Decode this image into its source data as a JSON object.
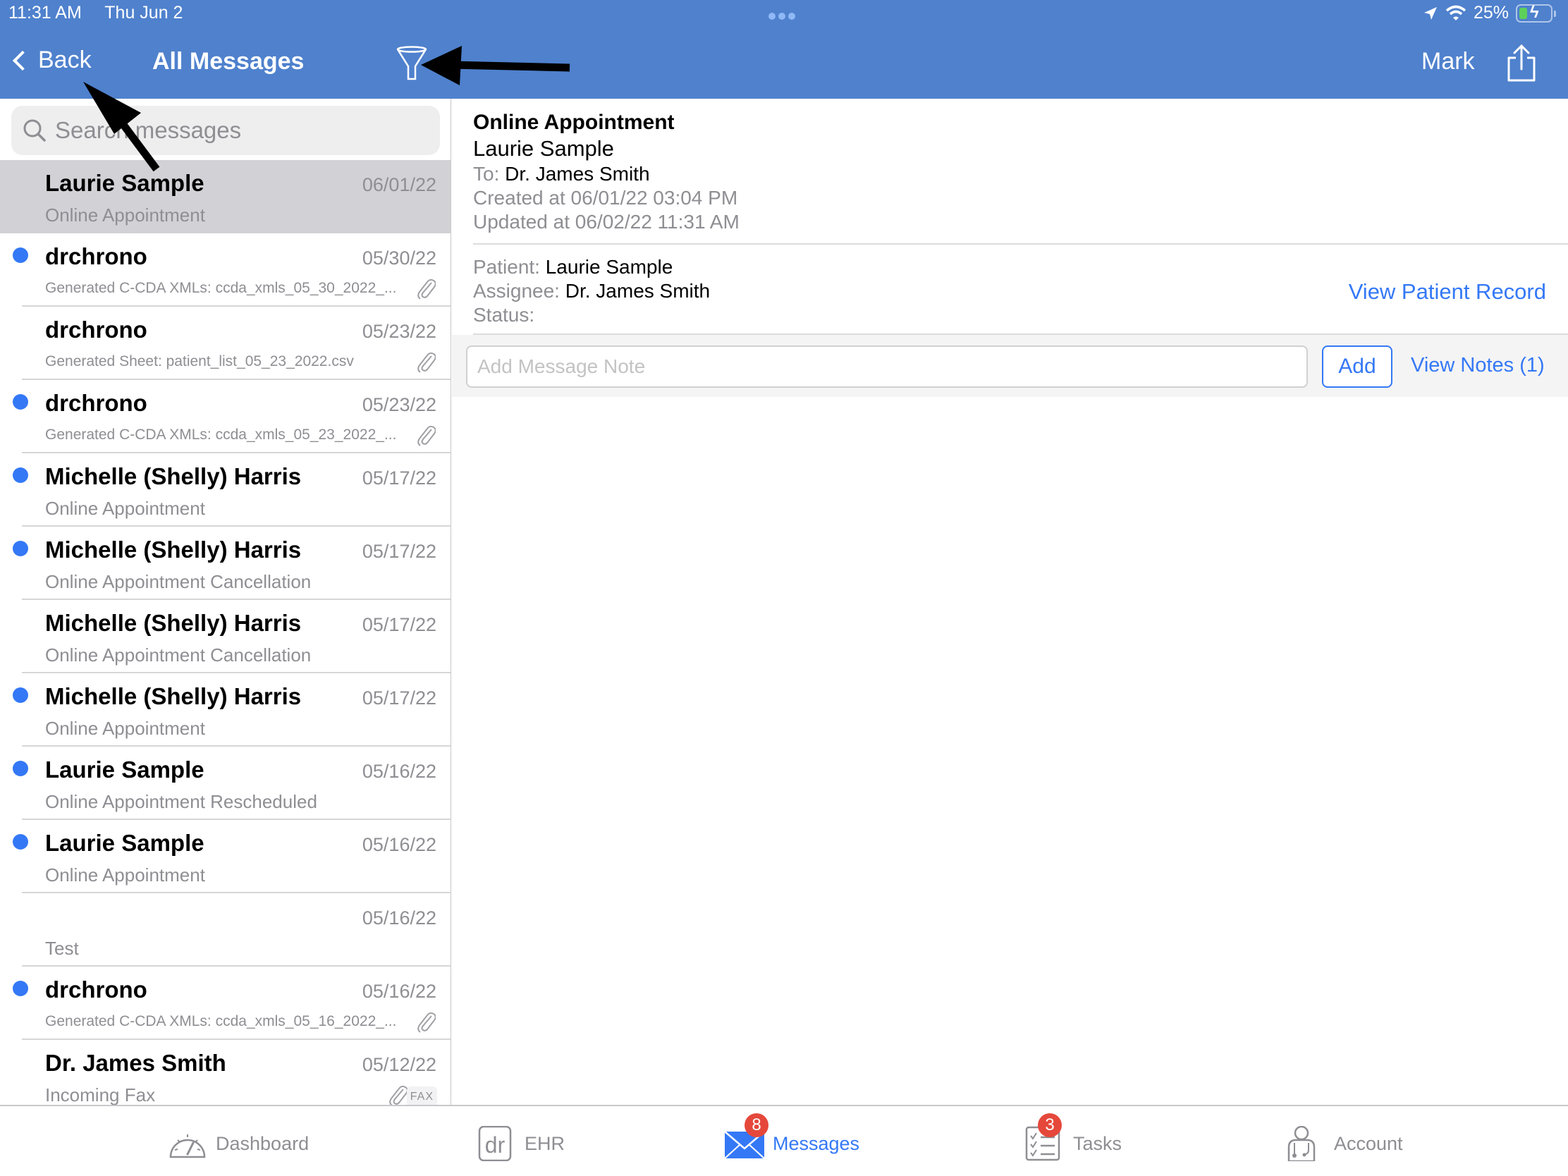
{
  "status_bar": {
    "time": "11:31 AM",
    "date": "Thu Jun 2",
    "battery": "25%"
  },
  "nav": {
    "back_label": "Back",
    "title": "All Messages",
    "mark_label": "Mark"
  },
  "search": {
    "placeholder": "Search messages"
  },
  "messages": [
    {
      "sender": "Laurie Sample",
      "date": "06/01/22",
      "subject": "Online Appointment",
      "unread": false,
      "selected": true,
      "attachment": false
    },
    {
      "sender": "drchrono",
      "date": "05/30/22",
      "subject": "Generated C-CDA XMLs: ccda_xmls_05_30_2022_...",
      "unread": true,
      "attachment": true
    },
    {
      "sender": "drchrono",
      "date": "05/23/22",
      "subject": "Generated Sheet: patient_list_05_23_2022.csv",
      "unread": false,
      "attachment": true
    },
    {
      "sender": "drchrono",
      "date": "05/23/22",
      "subject": "Generated C-CDA XMLs: ccda_xmls_05_23_2022_...",
      "unread": true,
      "attachment": true
    },
    {
      "sender": "Michelle (Shelly) Harris",
      "date": "05/17/22",
      "subject": "Online Appointment",
      "unread": true,
      "attachment": false
    },
    {
      "sender": "Michelle (Shelly) Harris",
      "date": "05/17/22",
      "subject": "Online Appointment Cancellation",
      "unread": true,
      "attachment": false
    },
    {
      "sender": "Michelle (Shelly) Harris",
      "date": "05/17/22",
      "subject": "Online Appointment Cancellation",
      "unread": false,
      "attachment": false
    },
    {
      "sender": "Michelle (Shelly) Harris",
      "date": "05/17/22",
      "subject": "Online Appointment",
      "unread": true,
      "attachment": false
    },
    {
      "sender": "Laurie Sample",
      "date": "05/16/22",
      "subject": "Online Appointment Rescheduled",
      "unread": true,
      "attachment": false
    },
    {
      "sender": "Laurie Sample",
      "date": "05/16/22",
      "subject": "Online Appointment",
      "unread": true,
      "attachment": false
    },
    {
      "sender": "",
      "date": "05/16/22",
      "subject": "Test",
      "unread": false,
      "attachment": false
    },
    {
      "sender": "drchrono",
      "date": "05/16/22",
      "subject": "Generated C-CDA XMLs: ccda_xmls_05_16_2022_...",
      "unread": true,
      "attachment": true
    },
    {
      "sender": "Dr. James Smith",
      "date": "05/12/22",
      "subject": "Incoming Fax",
      "unread": false,
      "attachment": true,
      "badge": "FAX"
    }
  ],
  "detail": {
    "subject": "Online Appointment",
    "from": "Laurie Sample",
    "to_label": "To:",
    "to": "Dr. James Smith",
    "created": "Created at 06/01/22 03:04 PM",
    "updated": "Updated at 06/02/22 11:31 AM",
    "patient_label": "Patient:",
    "patient": "Laurie Sample",
    "assignee_label": "Assignee:",
    "assignee": "Dr. James Smith",
    "status_label": "Status:",
    "status": "",
    "view_patient_record": "View Patient Record",
    "note_placeholder": "Add Message Note",
    "add_label": "Add",
    "view_notes": "View Notes (1)"
  },
  "tabs": [
    {
      "label": "Dashboard",
      "icon": "dashboard-gauge-icon",
      "badge": null,
      "active": false
    },
    {
      "label": "EHR",
      "icon": "ehr-dr-icon",
      "badge": null,
      "active": false
    },
    {
      "label": "Messages",
      "icon": "envelope-icon",
      "badge": "8",
      "active": true
    },
    {
      "label": "Tasks",
      "icon": "checklist-icon",
      "badge": "3",
      "active": false
    },
    {
      "label": "Account",
      "icon": "doctor-icon",
      "badge": null,
      "active": false
    }
  ],
  "colors": {
    "header": "#4f81cd",
    "accent": "#3478f6",
    "badge": "#e5483b",
    "selected_row": "#d1d1d6"
  }
}
